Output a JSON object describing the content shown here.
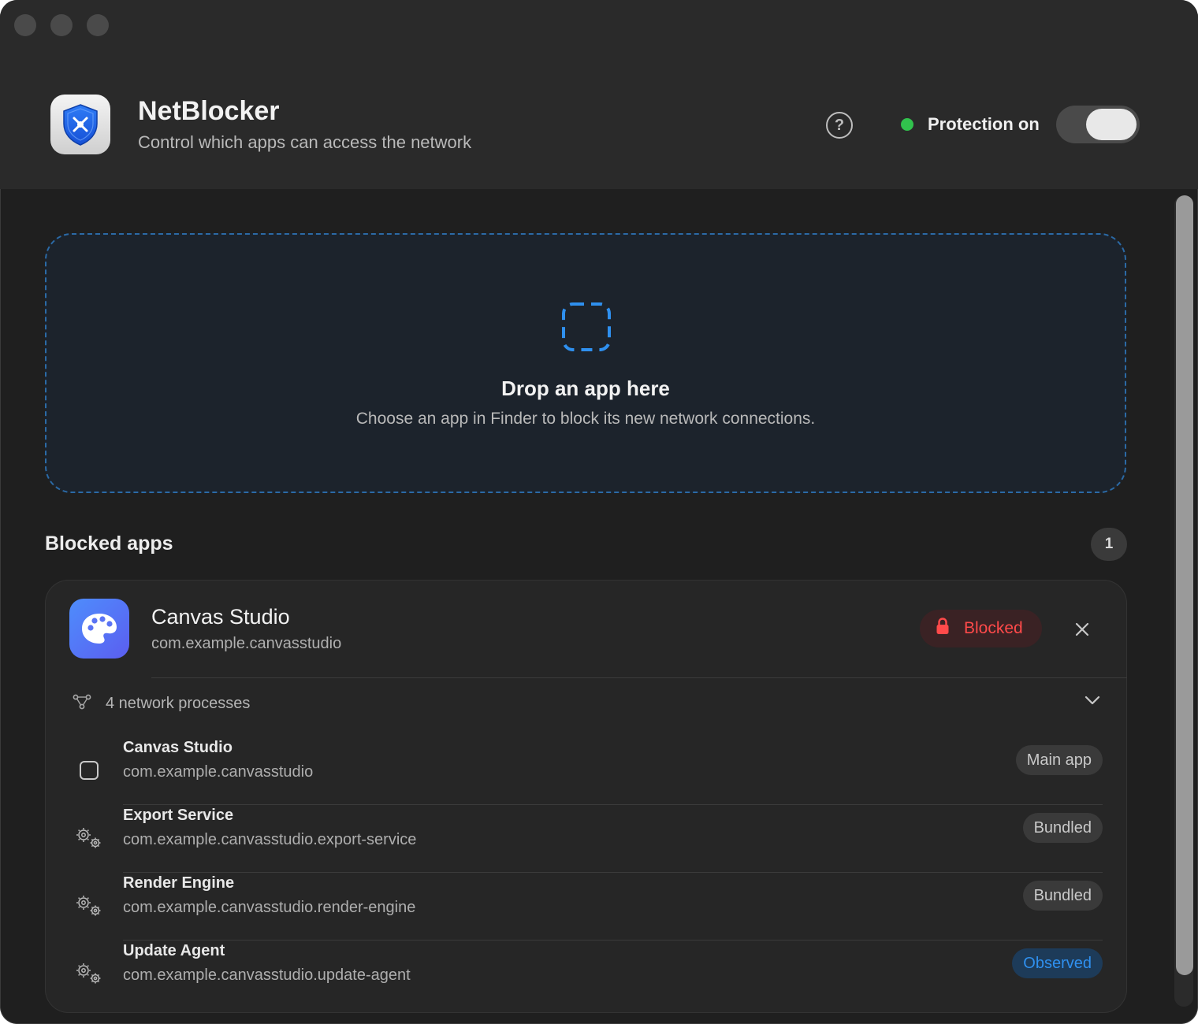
{
  "header": {
    "app_title": "NetBlocker",
    "app_subtitle": "Control which apps can access the network",
    "help_label": "?",
    "protection_status": "Protection on",
    "protection_enabled": true,
    "status_color": "#31c24d"
  },
  "dropzone": {
    "title": "Drop an app here",
    "subtitle": "Choose an app in Finder to block its new network connections.",
    "icon": "dashed-square-icon",
    "accent_color": "#2f90ef"
  },
  "blocked": {
    "section_title": "Blocked apps",
    "count": "1",
    "apps": [
      {
        "name": "Canvas Studio",
        "bundle_id": "com.example.canvasstudio",
        "icon": "palette-icon",
        "status": "Blocked",
        "status_color": "#ff4a4a",
        "processes_label": "4 network processes",
        "processes": [
          {
            "name": "Canvas Studio",
            "bundle_id": "com.example.canvasstudio",
            "tag": "Main app",
            "icon": "app-window-icon"
          },
          {
            "name": "Export Service",
            "bundle_id": "com.example.canvasstudio.export-service",
            "tag": "Bundled",
            "icon": "gears-icon"
          },
          {
            "name": "Render Engine",
            "bundle_id": "com.example.canvasstudio.render-engine",
            "tag": "Bundled",
            "icon": "gears-icon"
          },
          {
            "name": "Update Agent",
            "bundle_id": "com.example.canvasstudio.update-agent",
            "tag": "Observed",
            "icon": "gears-icon"
          }
        ]
      }
    ]
  }
}
